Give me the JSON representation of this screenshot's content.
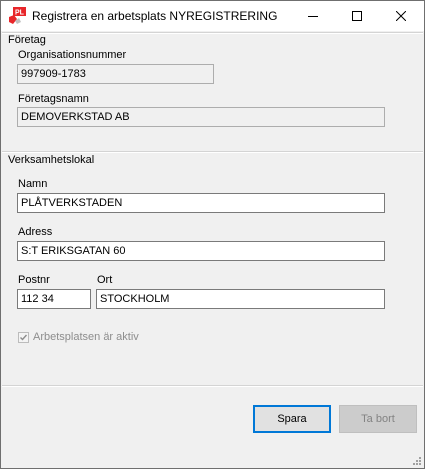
{
  "window": {
    "title": "Registrera en arbetsplats NYREGISTRERING",
    "icon": "app-logo-icon",
    "controls": [
      "minimize-icon",
      "maximize-icon",
      "close-icon"
    ]
  },
  "company": {
    "section_title": "Företag",
    "org_number_label": "Organisationsnummer",
    "org_number_value": "997909-1783",
    "name_label": "Företagsnamn",
    "name_value": "DEMOVERKSTAD AB"
  },
  "location": {
    "section_title": "Verksamhetslokal",
    "name_label": "Namn",
    "name_value": "PLÅTVERKSTADEN",
    "address_label": "Adress",
    "address_value": "S:T ERIKSGATAN 60",
    "postal_label": "Postnr",
    "postal_value": "112 34",
    "city_label": "Ort",
    "city_value": "STOCKHOLM"
  },
  "active": {
    "label": "Arbetsplatsen är aktiv",
    "checked": true,
    "enabled": false
  },
  "buttons": {
    "save_label": "Spara",
    "delete_label": "Ta bort"
  },
  "colors": {
    "focus_border": "#0078d7",
    "icon_red": "#e8262a"
  }
}
